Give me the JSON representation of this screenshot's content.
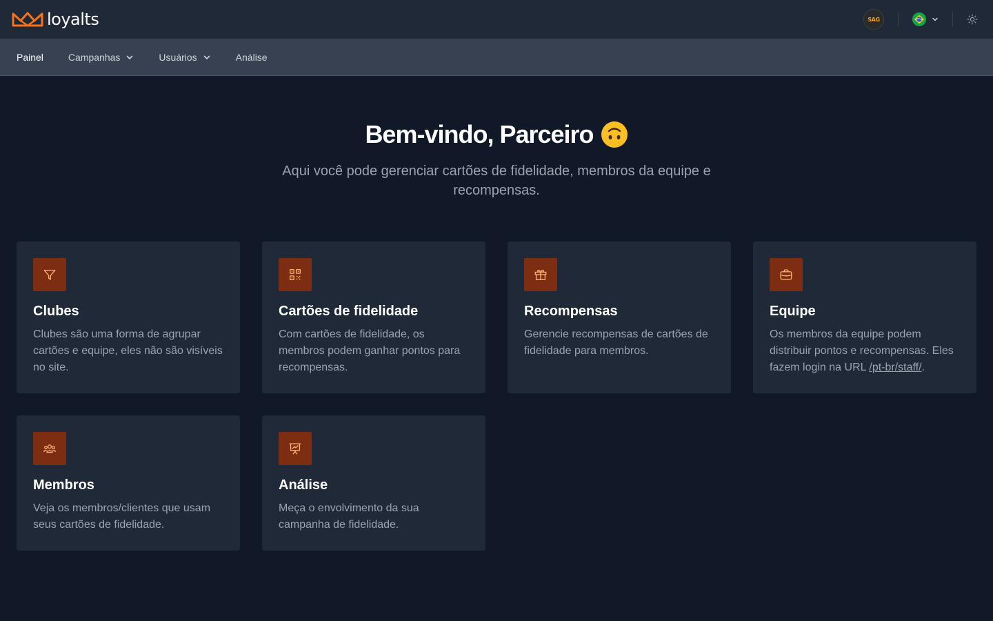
{
  "brand": {
    "name": "loyalts",
    "accent": "#f97316",
    "icon": "crown-logo-icon"
  },
  "header": {
    "avatar_label": "SAG",
    "language": {
      "selected": "Brazil flag",
      "icon": "brazil-flag-icon"
    },
    "theme_icon": "sun-icon"
  },
  "nav": {
    "items": [
      {
        "label": "Painel",
        "active": true,
        "dropdown": false
      },
      {
        "label": "Campanhas",
        "active": false,
        "dropdown": true
      },
      {
        "label": "Usuários",
        "active": false,
        "dropdown": true
      },
      {
        "label": "Análise",
        "active": false,
        "dropdown": false
      }
    ]
  },
  "hero": {
    "title": "Bem-vindo, Parceiro",
    "emoji": "upside-down-face",
    "subtitle": "Aqui você pode gerenciar cartões de fidelidade, membros da equipe e recompensas."
  },
  "cards": [
    {
      "icon": "funnel-icon",
      "title": "Clubes",
      "desc": "Clubes são uma forma de agrupar cartões e equipe, eles não são visíveis no site."
    },
    {
      "icon": "qr-code-icon",
      "title": "Cartões de fidelidade",
      "desc": "Com cartões de fidelidade, os membros podem ganhar pontos para recompensas."
    },
    {
      "icon": "gift-icon",
      "title": "Recompensas",
      "desc": "Gerencie recompensas de cartões de fidelidade para membros."
    },
    {
      "icon": "briefcase-icon",
      "title": "Equipe",
      "desc": "Os membros da equipe podem distribuir pontos e recompensas. Eles fazem login na URL",
      "link": "/pt-br/staff/",
      "desc_end": "."
    },
    {
      "icon": "users-group-icon",
      "title": "Membros",
      "desc": "Veja os membros/clientes que usam seus cartões de fidelidade."
    },
    {
      "icon": "presentation-chart-icon",
      "title": "Análise",
      "desc": "Meça o envolvimento da sua campanha de fidelidade."
    }
  ],
  "colors": {
    "background": "#111827",
    "topbar": "#1f2937",
    "navbar": "#374151",
    "card": "#1f2937",
    "icon_tile": "#7c2d12",
    "icon_stroke": "#fdba74"
  }
}
